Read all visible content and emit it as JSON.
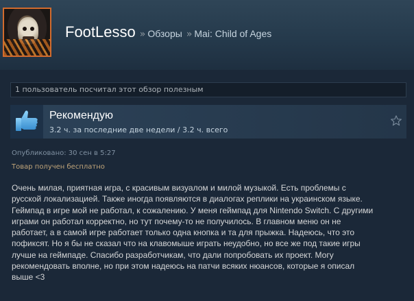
{
  "header": {
    "username": "FootLesso",
    "separator": "»",
    "crumb_reviews": "Обзоры",
    "crumb_game": "Mai: Child of Ages"
  },
  "helpful": {
    "text": "1 пользователь посчитал этот обзор полезным"
  },
  "recommendation": {
    "title": "Рекомендую",
    "hours": "3.2 ч. за последние две недели / 3.2 ч. всего",
    "thumb_icon": "thumbs-up-icon",
    "star_icon": "star-outline-icon"
  },
  "meta": {
    "posted": "Опубликовано: 30 сен в 5:27",
    "received_free": "Товар получен бесплатно"
  },
  "review": {
    "lines": [
      "Очень милая, приятная игра, с красивым визуалом и милой музыкой. Есть проблемы с",
      "русской локализацией. Также иногда появляются в диалогах реплики на украинском языке.",
      "Геймпад в игре мой не работал, к сожалению. У меня геймпад для Nintendo Switch. С другими",
      "играми он работал корректно, но тут почему-то не получилось. В главном меню он не",
      "работает, а в самой игре работает только одна кнопка и та для прыжка. Надеюсь, что это",
      "пофиксят. Но я бы не сказал что на клавомыше играть неудобно, но все же под такие игры",
      "лучше на геймпаде. Спасибо разработчикам, что дали попробовать их проект. Могу",
      "рекомендовать вполне, но при этом надеюсь на патчи всяких нюансов, которые я описал",
      "выше <3"
    ]
  },
  "colors": {
    "background": "#1b2838",
    "avatar_border": "#d26b2d",
    "free_text": "#c1a57a",
    "thumb": "#66c0f4"
  }
}
